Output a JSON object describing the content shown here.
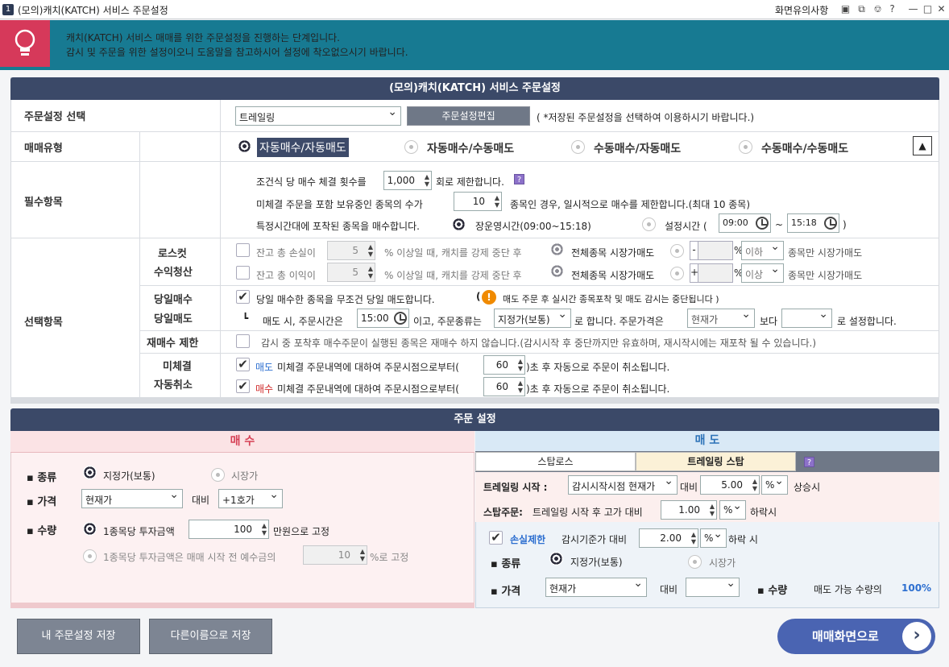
{
  "window": {
    "number": "1",
    "title": "(모의)캐치(KATCH) 서비스 주문설정",
    "notice": "화면유의사항"
  },
  "banner": {
    "line1": "캐치(KATCH) 서비스 매매를 위한 주문설정을 진행하는 단계입니다.",
    "line2": "감시 및 주문을 위한 설정이오니 도움말을 참고하시어 설정에 착오없으시기 바랍니다."
  },
  "settings": {
    "header": "(모의)캐치(KATCH) 서비스 주문설정",
    "select_label": "주문설정 선택",
    "select_value": "트레일링",
    "edit_btn": "주문설정편집",
    "select_note": "( *저장된 주문설정을 선택하여 이용하시기 바랍니다.)",
    "trade_type_label": "매매유형",
    "trade_types": [
      "자동매수/자동매도",
      "자동매수/수동매도",
      "수동매수/자동매도",
      "수동매수/수동매도"
    ],
    "required_label": "필수항목",
    "req1_pre": "조건식 당 매수 체결 횟수를",
    "req1_val": "1,000",
    "req1_post": "회로 제한합니다.",
    "req2_pre": "미체결 주문을 포함 보유중인 종목의 수가",
    "req2_val": "10",
    "req2_post": "종목인 경우, 일시적으로 매수를 제한합니다.(최대 10 종목)",
    "req3_pre": "특정시간대에 포착된 종목을 매수합니다.",
    "req3_opt1": "장운영시간(09:00~15:18)",
    "req3_opt2": "설정시간 (",
    "req3_start": "09:00",
    "req3_tilde": "~",
    "req3_end": "15:18",
    "req3_close": ")",
    "optional_label": "선택항목",
    "losscut_label1": "로스컷",
    "losscut_label2": "수익청산",
    "loss_pre": "잔고 총 손실이",
    "loss_val": "5",
    "loss_post": "% 이상일 때, 캐치를 강제 중단 후",
    "loss_opt1": "전체종목 시장가매도",
    "loss_sign": "-",
    "loss_pct": "%",
    "loss_cmp": "이하",
    "loss_post2": "종목만 시장가매도",
    "profit_pre": "잔고 총 이익이",
    "profit_val": "5",
    "profit_post": "% 이상일 때, 캐치를 강제 중단 후",
    "profit_opt1": "전체종목 시장가매도",
    "profit_sign": "+",
    "profit_pct": "%",
    "profit_cmp": "이상",
    "profit_post2": "종목만 시장가매도",
    "sameday_label1": "당일매수",
    "sameday_label2": "당일매도",
    "sameday_text": "당일 매수한 종목을 무조건 당일 매도합니다.",
    "sameday_warn_open": "(",
    "sameday_warn": "매도 주문 후 실시간 종목포착 및 매도 감시는 중단됩니다 )",
    "sameday2_mark": "┗",
    "sameday2_pre": "매도 시, 주문시간은",
    "sameday2_time": "15:00",
    "sameday2_mid": "이고, 주문종류는",
    "sameday2_type": "지정가(보통)",
    "sameday2_mid2": "로 합니다.  주문가격은",
    "sameday2_price": "현재가",
    "sameday2_mid3": "보다",
    "sameday2_offset": "",
    "sameday2_post": "로 설정합니다.",
    "rebuy_label": "재매수 제한",
    "rebuy_text": "감시 중 포착후 매수주문이 실행된 종목은 재매수 하지 않습니다.(감시시작 후 중단까지만 유효하며, 재시작시에는 재포착 될 수 있습니다.)",
    "unfilled_label1": "미체결",
    "unfilled_label2": "자동취소",
    "unfilled_sell_tag": "매도",
    "unfilled_buy_tag": "매수",
    "unfilled_pre": "미체결 주문내역에 대하여 주문시점으로부터(",
    "unfilled_sell_val": "60",
    "unfilled_buy_val": "60",
    "unfilled_post": ")초 후 자동으로 주문이 취소됩니다."
  },
  "order": {
    "header": "주문 설정",
    "buy_title": "매 수",
    "sell_title": "매 도",
    "buy": {
      "kind_label": "종류",
      "kind_opt1": "지정가(보통)",
      "kind_opt2": "시장가",
      "price_label": "가격",
      "price_value": "현재가",
      "compare_label": "대비",
      "compare_value": "+1호가",
      "qty_label": "수량",
      "qty_opt1_pre": "1종목당 투자금액",
      "qty_amount": "100",
      "qty_opt1_post": "만원으로 고정",
      "qty_opt2_pre": "1종목당 투자금액은 매매 시작 전 예수금의",
      "qty_pct": "10",
      "qty_opt2_post": "%로 고정"
    },
    "sell": {
      "tab1": "스탑로스",
      "tab2": "트레일링 스탑",
      "trail_label": "트레일링 시작 :",
      "trail_base": "감시시작시점 현재가",
      "trail_cmp": "대비",
      "trail_val": "5.00",
      "trail_unit": "%",
      "trail_post": "상승시",
      "stop_label": "스탑주문:",
      "stop_pre": "트레일링 시작 후 고가 대비",
      "stop_val": "1.00",
      "stop_unit": "%",
      "stop_post": "하락시",
      "loss_label": "손실제한",
      "loss_pre": "감시기준가 대비",
      "loss_val": "2.00",
      "loss_unit": "%",
      "loss_post": "하락 시",
      "kind_label": "종류",
      "kind_opt1": "지정가(보통)",
      "kind_opt2": "시장가",
      "price_label": "가격",
      "price_value": "현재가",
      "compare_label": "대비",
      "compare_value": "",
      "qty_label": "수량",
      "qty_text": "매도 가능 수량의",
      "qty_val": "100%"
    }
  },
  "footer": {
    "save": "내 주문설정 저장",
    "save_as": "다른이름으로 저장",
    "go": "매매화면으로"
  }
}
